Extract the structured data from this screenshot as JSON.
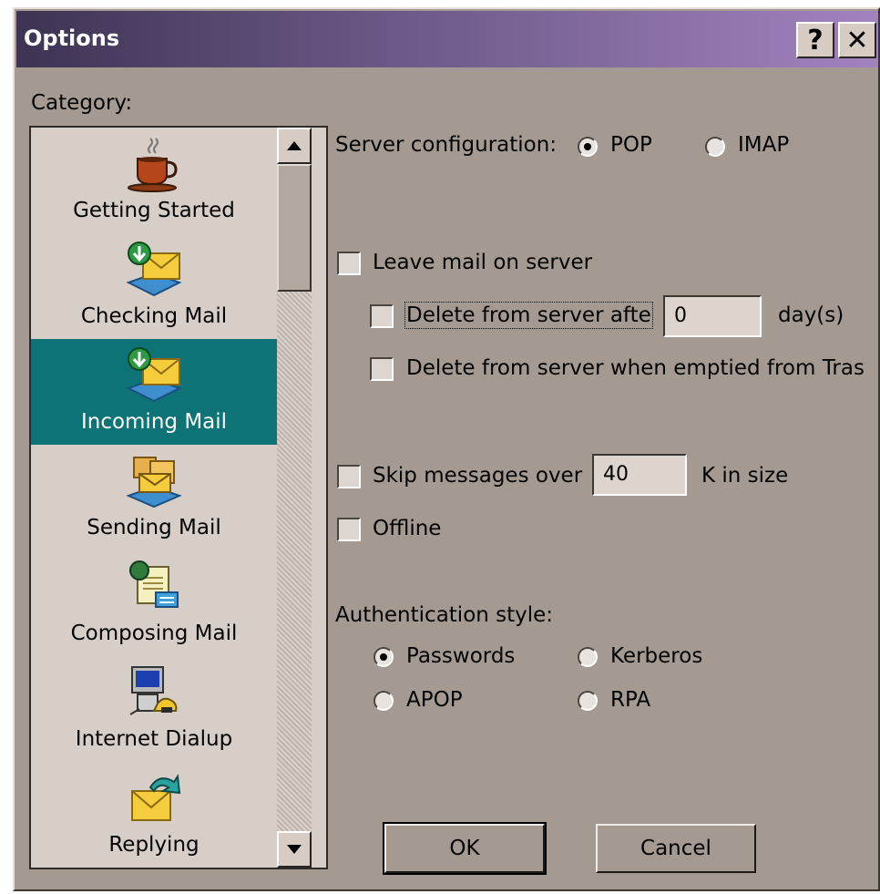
{
  "window": {
    "title": "Options",
    "help_label": "?",
    "close_label": "✕"
  },
  "category": {
    "label": "Category:",
    "items": [
      {
        "label": "Getting Started",
        "icon": "coffee-cup-icon",
        "selected": false
      },
      {
        "label": "Checking Mail",
        "icon": "mail-download-icon",
        "selected": false
      },
      {
        "label": "Incoming Mail",
        "icon": "mail-download-icon",
        "selected": true
      },
      {
        "label": "Sending Mail",
        "icon": "mail-packages-icon",
        "selected": false
      },
      {
        "label": "Composing Mail",
        "icon": "composing-document-icon",
        "selected": false
      },
      {
        "label": "Internet Dialup",
        "icon": "computer-phone-icon",
        "selected": false
      },
      {
        "label": "Replying",
        "icon": "reply-envelope-icon",
        "selected": false
      }
    ]
  },
  "server_config": {
    "label": "Server configuration:",
    "pop": "POP",
    "imap": "IMAP",
    "selected": "POP"
  },
  "leave_mail": {
    "label": "Leave mail on server",
    "checked": false
  },
  "delete_after": {
    "label": "Delete from server afte",
    "value": "0",
    "unit": "day(s)",
    "checked": false
  },
  "delete_trash": {
    "label": "Delete from server when emptied from Tras",
    "checked": false
  },
  "skip_messages": {
    "label": "Skip messages over",
    "value": "40",
    "unit": "K in size",
    "checked": false
  },
  "offline": {
    "label": "Offline",
    "checked": false
  },
  "auth": {
    "label": "Authentication style:",
    "passwords": "Passwords",
    "kerberos": "Kerberos",
    "apop": "APOP",
    "rpa": "RPA",
    "selected": "Passwords"
  },
  "buttons": {
    "ok": "OK",
    "cancel": "Cancel"
  },
  "colors": {
    "dialog_bg": "#a59a91",
    "selection": "#0d7376",
    "list_bg": "#d7cec7"
  }
}
